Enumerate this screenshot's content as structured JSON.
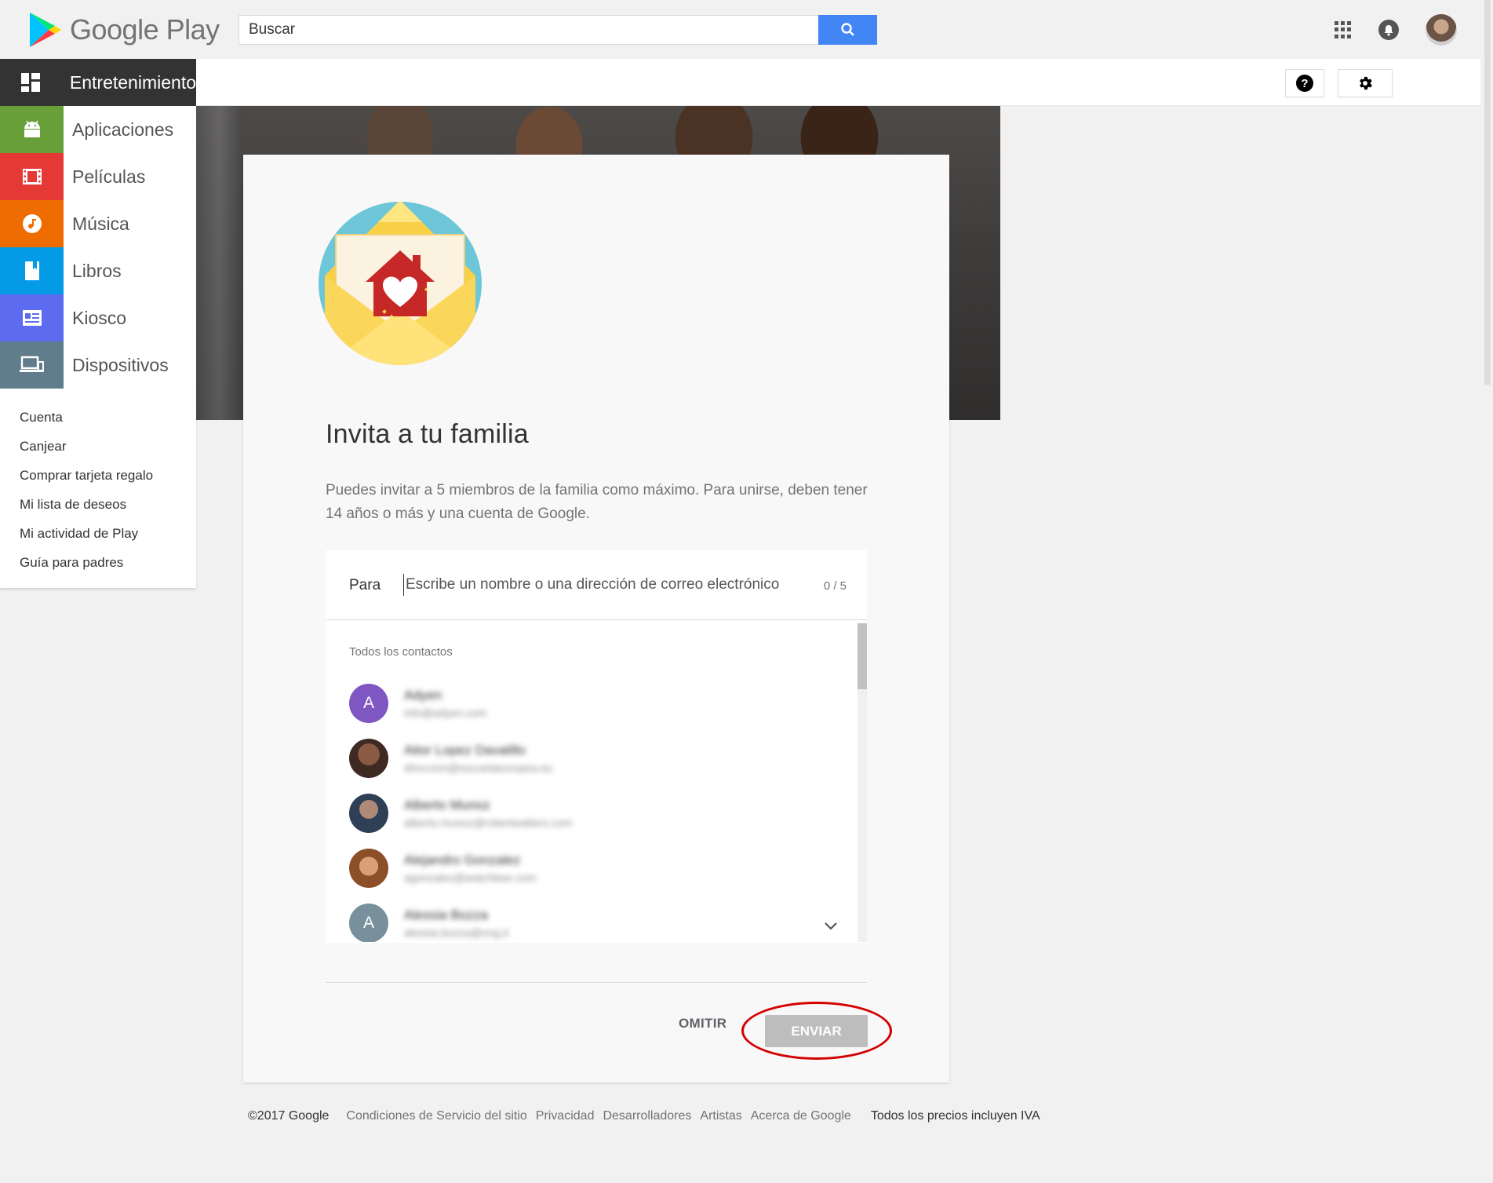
{
  "header": {
    "logo_text": "Google Play",
    "search_placeholder": "Buscar",
    "icons": [
      "search-icon",
      "apps-grid-icon",
      "notifications-bell-icon",
      "account-avatar"
    ]
  },
  "nav": {
    "items": [
      {
        "label": "Entretenimiento",
        "icon": "home-grid-icon",
        "color": "#333333",
        "active": true
      },
      {
        "label": "Aplicaciones",
        "icon": "android-icon",
        "color": "#689f38"
      },
      {
        "label": "Películas",
        "icon": "film-icon",
        "color": "#e53935"
      },
      {
        "label": "Música",
        "icon": "music-note-icon",
        "color": "#ef6c00"
      },
      {
        "label": "Libros",
        "icon": "book-icon",
        "color": "#039be5"
      },
      {
        "label": "Kiosco",
        "icon": "newsstand-icon",
        "color": "#5c6bf0"
      },
      {
        "label": "Dispositivos",
        "icon": "devices-icon",
        "color": "#607d8b"
      }
    ],
    "links": [
      "Cuenta",
      "Canjear",
      "Comprar tarjeta regalo",
      "Mi lista de deseos",
      "Mi actividad de Play",
      "Guía para padres"
    ]
  },
  "subbar": {
    "icons": [
      "help-icon",
      "settings-gear-icon"
    ]
  },
  "invite": {
    "title": "Invita a tu familia",
    "description": "Puedes invitar a 5 miembros de la familia como máximo. Para unirse, deben tener 14 años o más y una cuenta de Google.",
    "to_label": "Para",
    "to_placeholder": "Escribe un nombre o una dirección de correo electrónico",
    "counter": "0 / 5",
    "contacts_heading": "Todos los contactos",
    "contacts": [
      {
        "initial": "A",
        "name": "Adyen",
        "email": "info@adyen.com",
        "avatar_color": "#7e57c2"
      },
      {
        "initial": "",
        "name": "Aitor Lopez Davalillo",
        "email": "direccion@escuelaeuropea.eu",
        "avatar_color": "#5d4037"
      },
      {
        "initial": "",
        "name": "Alberto Munoz",
        "email": "alberto.munoz@robertwalters.com",
        "avatar_color": "#546e7a"
      },
      {
        "initial": "",
        "name": "Alejandro Gonzalez",
        "email": "agonzalez@watchbee.com",
        "avatar_color": "#8d4e2a"
      },
      {
        "initial": "A",
        "name": "Alessia Bozza",
        "email": "alessia.bozza@ong.it",
        "avatar_color": "#78909c"
      }
    ],
    "skip_label": "OMITIR",
    "send_label": "ENVIAR"
  },
  "footer": {
    "copyright": "©2017 Google",
    "links": [
      "Condiciones de Servicio del sitio",
      "Privacidad",
      "Desarrolladores",
      "Artistas",
      "Acerca de Google"
    ],
    "vat_note": "Todos los precios incluyen IVA"
  }
}
